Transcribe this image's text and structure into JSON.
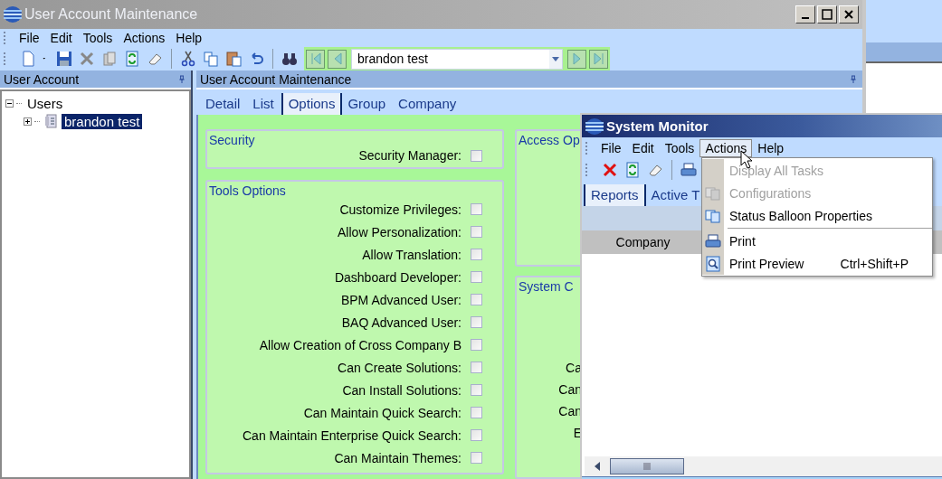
{
  "main_window": {
    "title": "User Account Maintenance",
    "menu": [
      "File",
      "Edit",
      "Tools",
      "Actions",
      "Help"
    ],
    "search_combo": {
      "value": "brandon test"
    },
    "left_pane": {
      "title": "User Account",
      "tree": [
        {
          "label": "Users",
          "expanded": true,
          "selected": false,
          "children": [
            {
              "label": "brandon test",
              "expanded": false,
              "selected": true
            }
          ]
        }
      ]
    },
    "right_pane": {
      "title": "User Account Maintenance",
      "tabs": [
        {
          "label": "Detail",
          "selected": false
        },
        {
          "label": "List",
          "selected": false
        },
        {
          "label": "Options",
          "selected": true
        },
        {
          "label": "Group",
          "selected": false
        },
        {
          "label": "Company",
          "selected": false
        }
      ],
      "groups": [
        {
          "title": "Security",
          "options": [
            {
              "label": "Security Manager:",
              "checked": false
            }
          ]
        },
        {
          "title": "Tools Options",
          "options": [
            {
              "label": "Customize Privileges:",
              "checked": false
            },
            {
              "label": "Allow Personalization:",
              "checked": false
            },
            {
              "label": "Allow Translation:",
              "checked": false
            },
            {
              "label": "Dashboard Developer:",
              "checked": false
            },
            {
              "label": "BPM Advanced User:",
              "checked": false
            },
            {
              "label": "BAQ Advanced User:",
              "checked": false
            },
            {
              "label": "Allow Creation of Cross Company B",
              "checked": false
            },
            {
              "label": "Can Create Solutions:",
              "checked": false
            },
            {
              "label": "Can Install Solutions:",
              "checked": false
            },
            {
              "label": "Can Maintain Quick Search:",
              "checked": false
            },
            {
              "label": "Can Maintain Enterprise Quick Search:",
              "checked": false
            },
            {
              "label": "Can Maintain Themes:",
              "checked": false
            }
          ]
        }
      ],
      "side_groups": [
        {
          "title": "Access Op"
        },
        {
          "title": "System C",
          "labels": [
            "Ca",
            "Can",
            "Can",
            "E"
          ]
        }
      ]
    }
  },
  "system_monitor": {
    "title": "System Monitor",
    "menu": [
      {
        "label": "File",
        "selected": false
      },
      {
        "label": "Edit",
        "selected": false
      },
      {
        "label": "Tools",
        "selected": false
      },
      {
        "label": "Actions",
        "selected": true
      },
      {
        "label": "Help",
        "selected": false
      }
    ],
    "tabs": [
      {
        "label": "Reports",
        "selected": true
      },
      {
        "label": "Active T",
        "selected": false
      }
    ],
    "columns": [
      "Company"
    ],
    "actions_menu": [
      {
        "kind": "item",
        "label": "Display All Tasks",
        "disabled": true
      },
      {
        "kind": "item",
        "label": "Configurations",
        "disabled": true
      },
      {
        "kind": "item",
        "label": "Status Balloon Properties",
        "disabled": false
      },
      {
        "kind": "separator"
      },
      {
        "kind": "item",
        "label": "Print",
        "disabled": false
      },
      {
        "kind": "item",
        "label": "Print Preview",
        "disabled": false,
        "shortcut": "Ctrl+Shift+P"
      }
    ]
  }
}
